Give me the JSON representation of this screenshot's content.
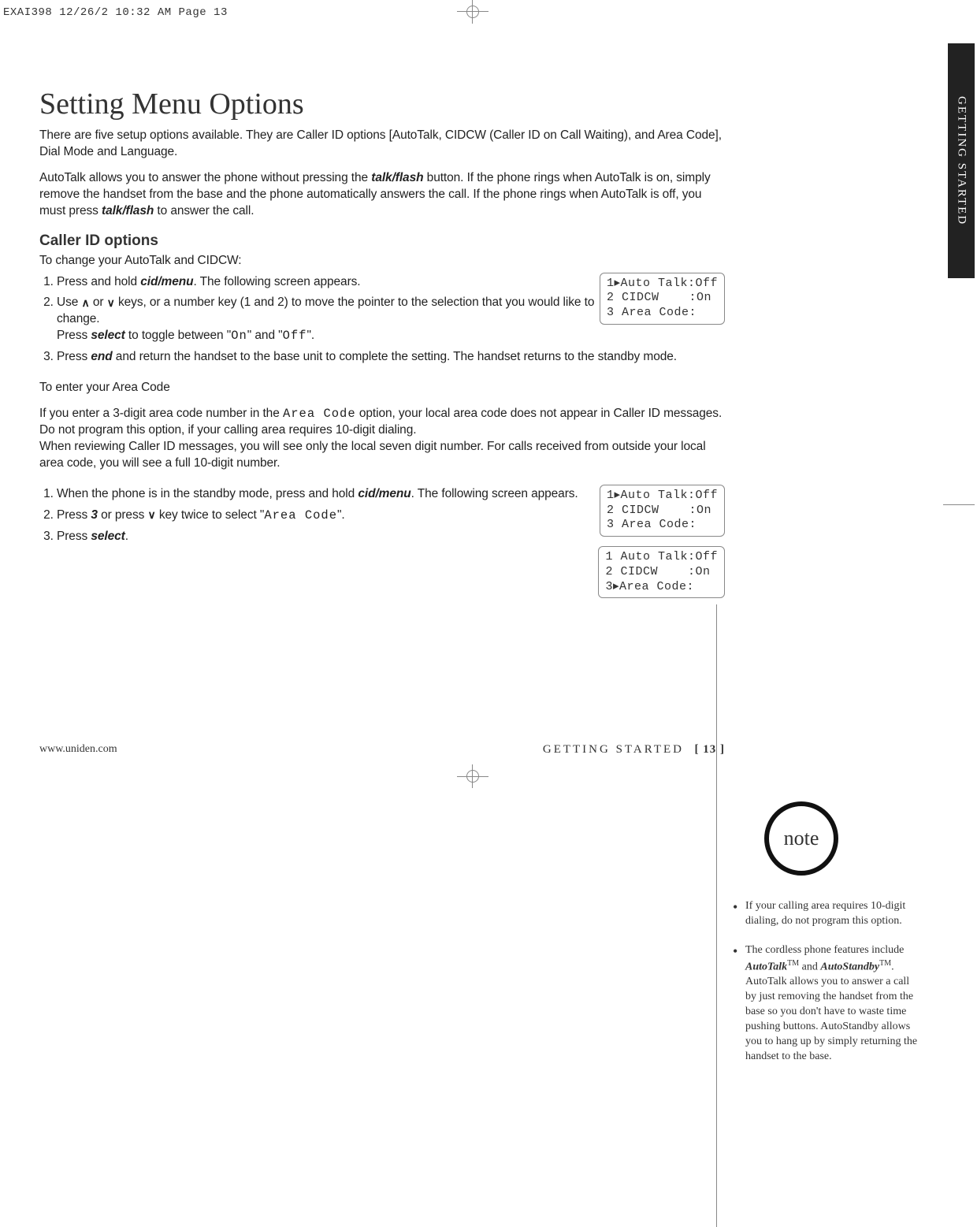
{
  "print_header": "EXAI398  12/26/2  10:32 AM  Page 13",
  "side_tab": "GETTING STARTED",
  "title": "Setting Menu Options",
  "intro": "There are five setup options available. They are Caller ID options [AutoTalk, CIDCW (Caller ID on Call Waiting), and Area Code], Dial Mode and Language.",
  "autotalk_para_a": "AutoTalk allows you to answer the phone without pressing the ",
  "autotalk_btn1": "talk/flash",
  "autotalk_para_b": " button. If the phone rings when AutoTalk is on, simply remove the handset from the base and the phone automatically answers the call. If the phone rings when AutoTalk is off, you must press ",
  "autotalk_btn2": "talk/flash",
  "autotalk_para_c": " to answer the call.",
  "h2": "Caller ID options",
  "sub_intro": "To change your AutoTalk and CIDCW:",
  "step1_a": "Press and hold ",
  "step1_btn": "cid/menu",
  "step1_b": ". The following screen appears.",
  "step2_a": "Use ",
  "step2_b": " or ",
  "step2_c": " keys, or a number key (1 and 2) to move the pointer to the selection that you would like to change.",
  "step2_d": "Press ",
  "step2_btn": "select",
  "step2_e": " to toggle between \"",
  "lcd_on": "On",
  "step2_f": "\" and \"",
  "lcd_off": "Off",
  "step2_g": "\".",
  "step3_a": "Press ",
  "step3_btn": "end",
  "step3_b": " and return the handset to the base unit to complete the setting. The handset returns to the standby mode.",
  "area_head": "To enter your Area Code",
  "area_para_a": "If you enter a 3-digit area code number in the ",
  "area_lcd": "Area Code",
  "area_para_b": " option, your local area code does not appear in Caller ID messages. Do not program this option, if your calling area requires 10-digit dialing.",
  "area_para_c": "When reviewing Caller ID messages, you will see only the local seven digit number. For calls received from outside your local area code, you will see a full 10-digit number.",
  "astep1_a": "When the phone is in the standby mode, press and hold ",
  "astep1_btn": "cid/menu",
  "astep1_b": ". The following screen appears.",
  "astep2_a": "Press ",
  "astep2_num": "3",
  "astep2_b": " or press ",
  "astep2_c": " key twice to select \"",
  "astep2_lcd": "Area Code",
  "astep2_d": "\".",
  "astep3_a": "Press ",
  "astep3_btn": "select",
  "astep3_b": ".",
  "lcd1": "1▸Auto Talk:Off\n2 CIDCW    :On\n3 Area Code:",
  "lcd2": "1▸Auto Talk:Off\n2 CIDCW    :On\n3 Area Code:",
  "lcd3": "1 Auto Talk:Off\n2 CIDCW    :On\n3▸Area Code:",
  "note_label": "note",
  "note1": "If your calling area requires 10-digit dialing, do not program this option.",
  "note2_a": "The cordless phone features include ",
  "note2_b": "AutoTalk",
  "note2_c": " and ",
  "note2_d": "AutoStandby",
  "note2_e": ". AutoTalk allows you to answer a call by just removing the handset from the base so you don't have to waste time pushing buttons. AutoStandby allows you to hang up by simply returning the handset to the base.",
  "footer_url": "www.uniden.com",
  "footer_section": "GETTING STARTED",
  "footer_page": "[ 13 ]"
}
